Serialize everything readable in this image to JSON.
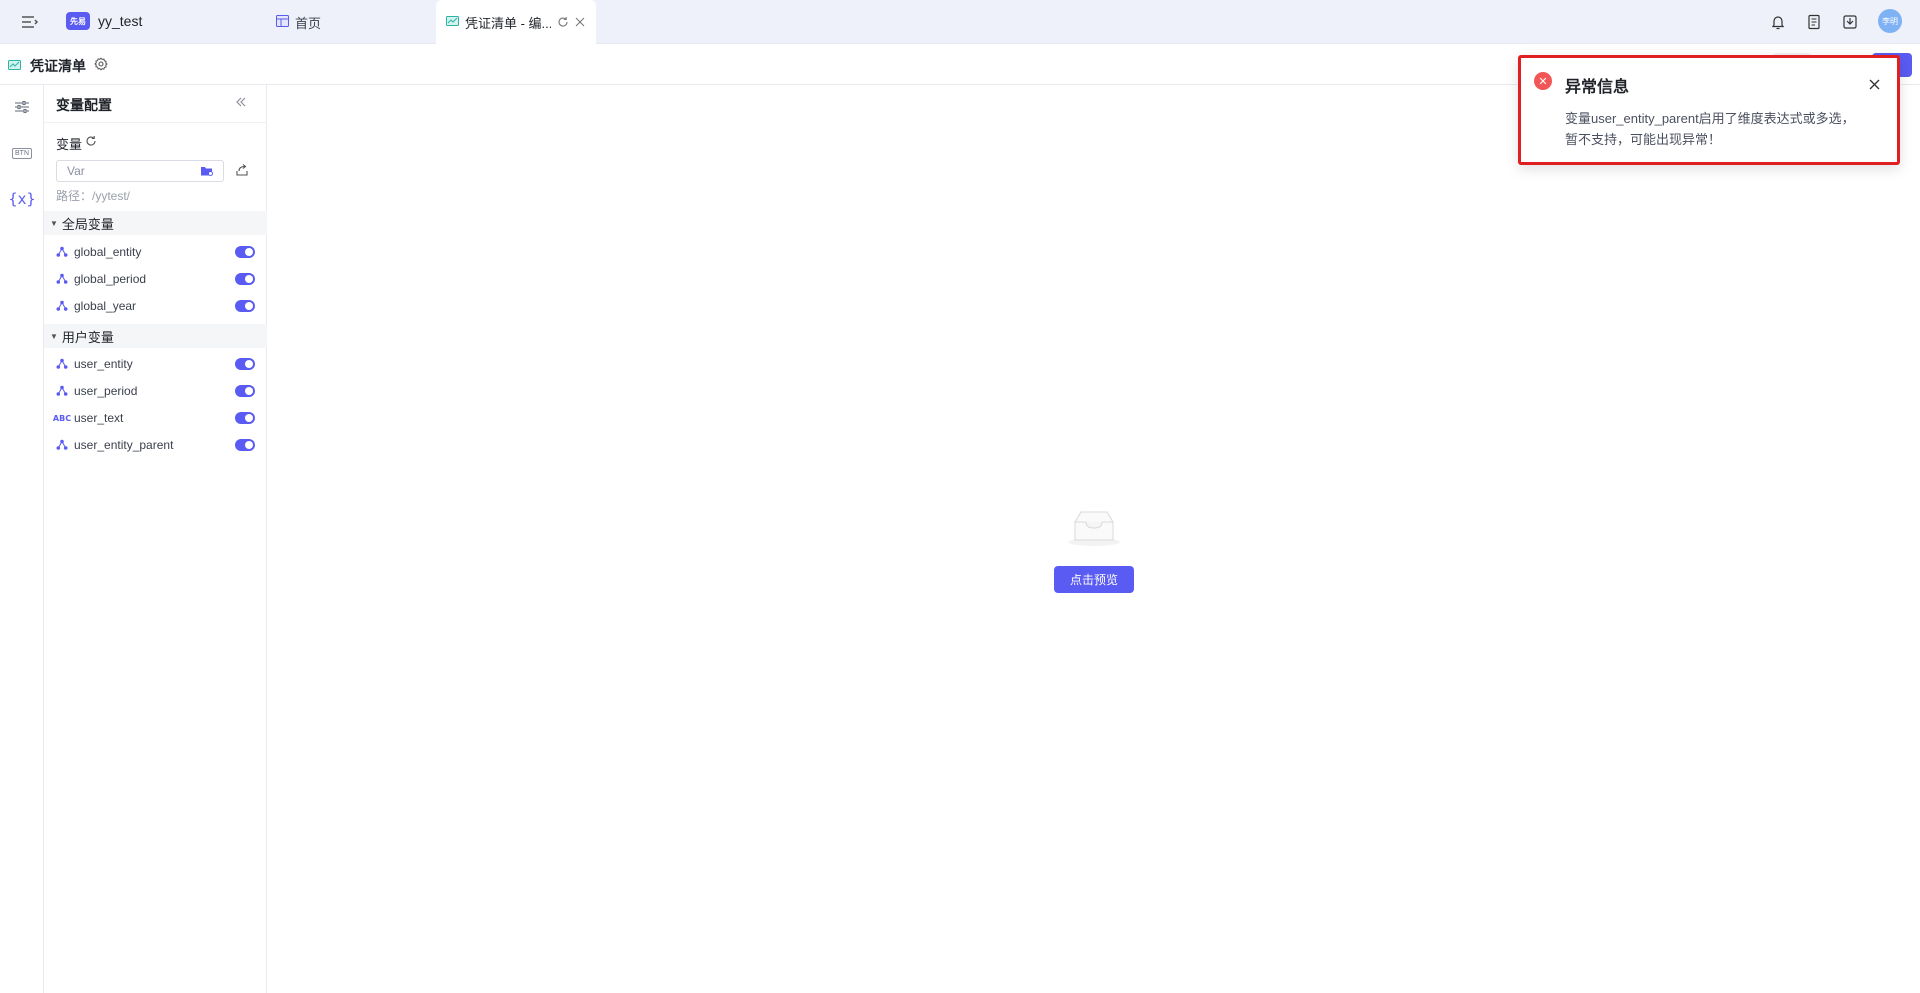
{
  "app": {
    "logo_text": "先易",
    "name": "yy_test"
  },
  "tabs": [
    {
      "label": "首页"
    },
    {
      "label": "凭证清单 - 编..."
    }
  ],
  "user": {
    "avatar_text": "李明"
  },
  "document": {
    "title": "凭证清单"
  },
  "rail": {
    "btn_text": "BTN",
    "var_text": "{x}"
  },
  "panel": {
    "title": "变量配置",
    "var_label": "变量",
    "search_placeholder": "Var",
    "path_text": "路径：/yytest/",
    "groups": [
      {
        "label": "全局变量",
        "items": [
          {
            "name": "global_entity",
            "type": "dimension",
            "enabled": true
          },
          {
            "name": "global_period",
            "type": "dimension",
            "enabled": true
          },
          {
            "name": "global_year",
            "type": "dimension",
            "enabled": true
          }
        ]
      },
      {
        "label": "用户变量",
        "items": [
          {
            "name": "user_entity",
            "type": "dimension",
            "enabled": true
          },
          {
            "name": "user_period",
            "type": "dimension",
            "enabled": true
          },
          {
            "name": "user_text",
            "type": "text",
            "icon_text": "ABC",
            "enabled": true
          },
          {
            "name": "user_entity_parent",
            "type": "dimension",
            "enabled": true
          }
        ]
      }
    ]
  },
  "main": {
    "preview_button": "点击预览"
  },
  "notice": {
    "title": "异常信息",
    "line1": "变量user_entity_parent启用了维度表达式或多选，",
    "line2": "暂不支持，可能出现异常！"
  },
  "colors": {
    "accent": "#5a5bf2",
    "error": "#f25757",
    "highlight_border": "#e02020"
  }
}
